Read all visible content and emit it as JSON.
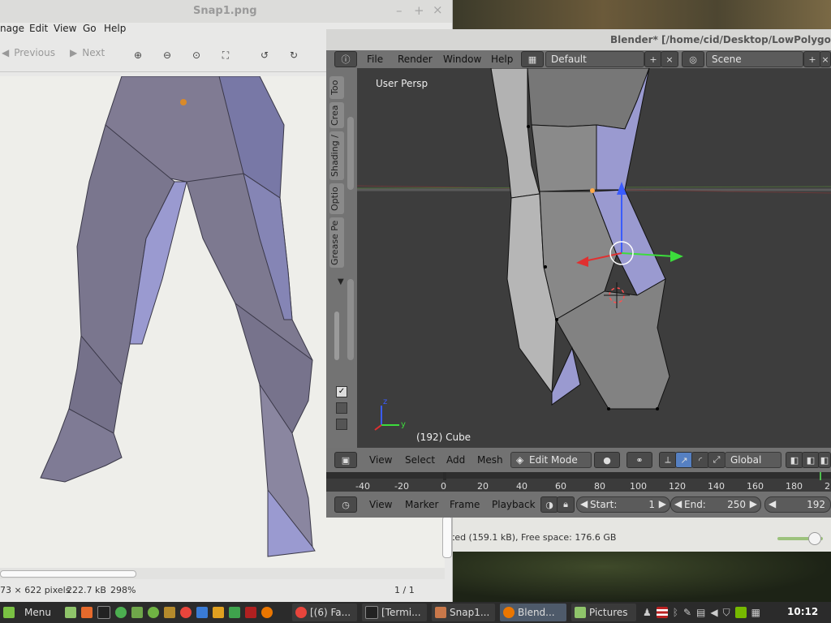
{
  "viewer": {
    "title": "Snap1.png",
    "controls": {
      "minimize": "–",
      "maximize": "+",
      "close": "×"
    },
    "menu": [
      "nage",
      "Edit",
      "View",
      "Go",
      "Help"
    ],
    "toolbar": {
      "previous": "Previous",
      "next": "Next"
    },
    "status": {
      "dimensions": "73 × 622 pixels",
      "size": "222.7 kB",
      "zoom": "298%",
      "page": "1 / 1"
    }
  },
  "file_manager_status": "ted (159.1 kB), Free space: 176.6 GB",
  "blender": {
    "title": "Blender* [/home/cid/Desktop/LowPolygonMa",
    "menu": [
      "File",
      "Render",
      "Window",
      "Help"
    ],
    "layout": "Default",
    "scene": "Scene",
    "tabs": [
      "Too",
      "Crea",
      "Shading /",
      "Optio",
      "Grease Pe"
    ],
    "viewport_label": "User Persp",
    "object_label": "(192) Cube",
    "axis_z": "z",
    "axis_y": "y",
    "view_header": {
      "view": "View",
      "select": "Select",
      "add": "Add",
      "mesh": "Mesh",
      "mode": "Edit Mode",
      "orientation": "Global"
    },
    "timeline_ticks": [
      "-40",
      "-20",
      "0",
      "20",
      "40",
      "60",
      "80",
      "100",
      "120",
      "140",
      "160",
      "180",
      "2"
    ],
    "timeline_header": {
      "view": "View",
      "marker": "Marker",
      "frame": "Frame",
      "playback": "Playback",
      "start_label": "Start:",
      "start_value": "1",
      "end_label": "End:",
      "end_value": "250",
      "current_frame": "192"
    }
  },
  "taskbar": {
    "menu": "Menu",
    "tasks": [
      "[(6) Fa...",
      "[Termi...",
      "Snap1...",
      "Blend...",
      "Pictures"
    ],
    "clock": "10:12"
  },
  "colors": {
    "blender_bg": "#404040",
    "viewer_bg": "#f0f0ee",
    "taskbar": "#2b2b2b",
    "leg_purple": "#7e7b93",
    "leg_blue": "#9a9ad0"
  }
}
